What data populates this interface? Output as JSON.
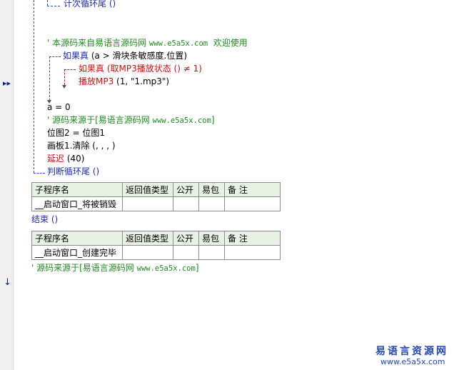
{
  "gutter": {
    "current_line_marker": "▸▸",
    "down_marker": "↓"
  },
  "code": {
    "line1": "计次循环尾 ()",
    "line2_prefix": "' 本源码来自易语言源码网 ",
    "line2_url": "www.e5a5x.com",
    "line2_suffix": "  欢迎使用",
    "line3_kw": "如果真",
    "line3_cond": " (a > 滑块条敏感度.位置)",
    "line4_kw": "如果真",
    "line4_cond": " (取MP3播放状态 () ≠ 1)",
    "line5_cmd": "播放MP3",
    "line5_args": " (1, \"1.mp3\")",
    "line6": "a = 0",
    "line7_prefix": "' 源码来源于[易语言源码网 ",
    "line7_url": "www.e5a5x.com",
    "line7_suffix": "]",
    "line8": "位图2 = 位图1",
    "line9": "画板1.清除 (, , , )",
    "line10_cmd": "延迟",
    "line10_args": " (40)",
    "line11": "判断循环尾 ()",
    "end_line": "结束 ()",
    "last_comment_prefix": "' 源码来源于[易语言源码网 ",
    "last_comment_url": "www.e5a5x.com",
    "last_comment_suffix": "]"
  },
  "proc_tables": [
    {
      "headers": [
        "子程序名",
        "返回值类型",
        "公开",
        "易包",
        "备 注"
      ],
      "name": "__启动窗口_将被销毁",
      "cells": [
        "",
        "",
        "",
        ""
      ]
    },
    {
      "headers": [
        "子程序名",
        "返回值类型",
        "公开",
        "易包",
        "备 注"
      ],
      "name": "__启动窗口_创建完毕",
      "cells": [
        "",
        "",
        "",
        ""
      ]
    }
  ],
  "watermark": {
    "title": "易语言资源网",
    "url": "www.e5a5x.com"
  },
  "colors": {
    "comment": "#1f8a1f",
    "keyword_red": "#c81414",
    "flow_blue": "#1f2aa8",
    "table_header_bg": "#e8f2e4",
    "watermark": "#2548b0"
  }
}
